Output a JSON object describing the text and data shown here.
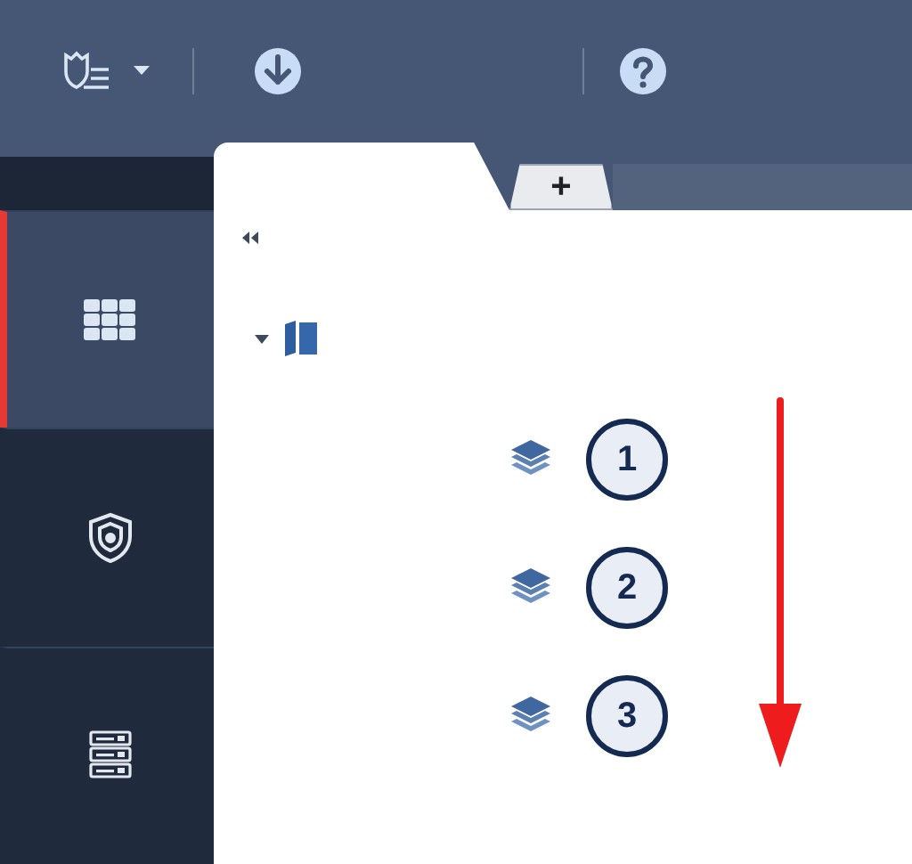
{
  "toolbar": {
    "menu_caret": true
  },
  "tabs": [
    {
      "kind": "blank",
      "selected": true
    },
    {
      "kind": "add",
      "label": "+",
      "selected": false
    }
  ],
  "sidebar": {
    "items": [
      {
        "kind": "grid",
        "selected": true
      },
      {
        "kind": "shield",
        "selected": false
      },
      {
        "kind": "server",
        "selected": false
      }
    ]
  },
  "tree": {
    "expanded": true,
    "layers": [
      {
        "number": "1"
      },
      {
        "number": "2"
      },
      {
        "number": "3"
      }
    ]
  }
}
